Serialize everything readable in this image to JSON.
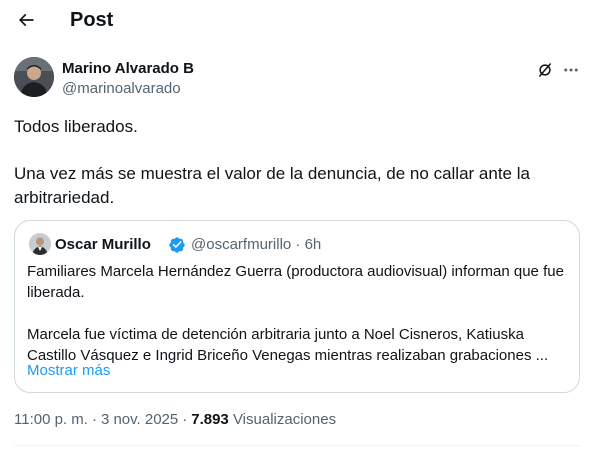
{
  "header": {
    "title": "Post"
  },
  "author": {
    "name": "Marino Alvarado B",
    "handle": "@marinoalvarado"
  },
  "post": {
    "line1": "Todos liberados.",
    "line2": "Una vez más se muestra el valor de la denuncia, de no callar ante la arbitrariedad."
  },
  "quoted_post": {
    "name": "Oscar Murillo",
    "handle_time": "@oscarfmurillo · 6h",
    "para1": "Familiares Marcela Hernández Guerra (productora audiovisual) informan que fue liberada.",
    "para2": "Marcela fue víctima de detención arbitraria junto a Noel Cisneros, Katiuska Castillo Vásquez e Ingrid Briceño Venegas mientras realizaban grabaciones ...",
    "show_more": "Mostrar más",
    "verified_color": "#1d9bf0"
  },
  "meta": {
    "time": "11:00 p. m.",
    "date": "3 nov. 2025",
    "separator": "·",
    "views_count": "7.893",
    "views_label": "Visualizaciones"
  },
  "icons": {
    "back": "arrow-left-icon",
    "grok": "grok-icon",
    "more": "more-horizontal-icon",
    "verified": "verified-badge-icon"
  }
}
